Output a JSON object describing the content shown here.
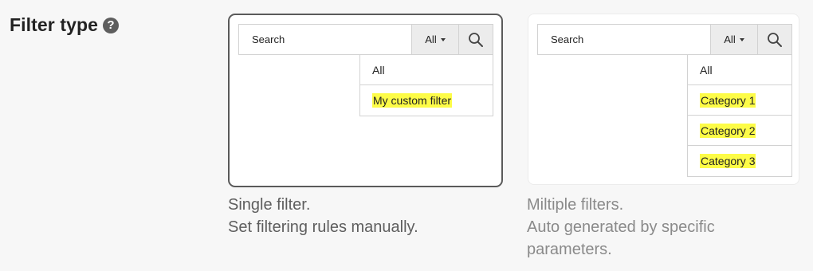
{
  "field": {
    "label": "Filter type",
    "help_icon": "question-circle-icon",
    "help_glyph": "?"
  },
  "options": [
    {
      "id": "single",
      "selected": true,
      "preview": {
        "search_placeholder": "Search",
        "filter_toggle_label": "All",
        "search_icon": "magnifier-icon",
        "dropdown_items": [
          "All",
          "My custom filter"
        ],
        "highlighted_items": [
          "My custom filter"
        ]
      },
      "caption_lines": [
        "Single filter.",
        "Set filtering rules manually."
      ]
    },
    {
      "id": "multiple",
      "selected": false,
      "preview": {
        "search_placeholder": "Search",
        "filter_toggle_label": "All",
        "search_icon": "magnifier-icon",
        "dropdown_items": [
          "All",
          "Category 1",
          "Category 2",
          "Category 3"
        ],
        "highlighted_items": [
          "Category 1",
          "Category 2",
          "Category 3"
        ]
      },
      "caption_lines": [
        "Miltiple filters.",
        "Auto generated by specific",
        "parameters."
      ]
    }
  ],
  "colors": {
    "highlight": "#fdfc47",
    "selected_border": "#5a5a5a",
    "background": "#f7f7f7"
  }
}
